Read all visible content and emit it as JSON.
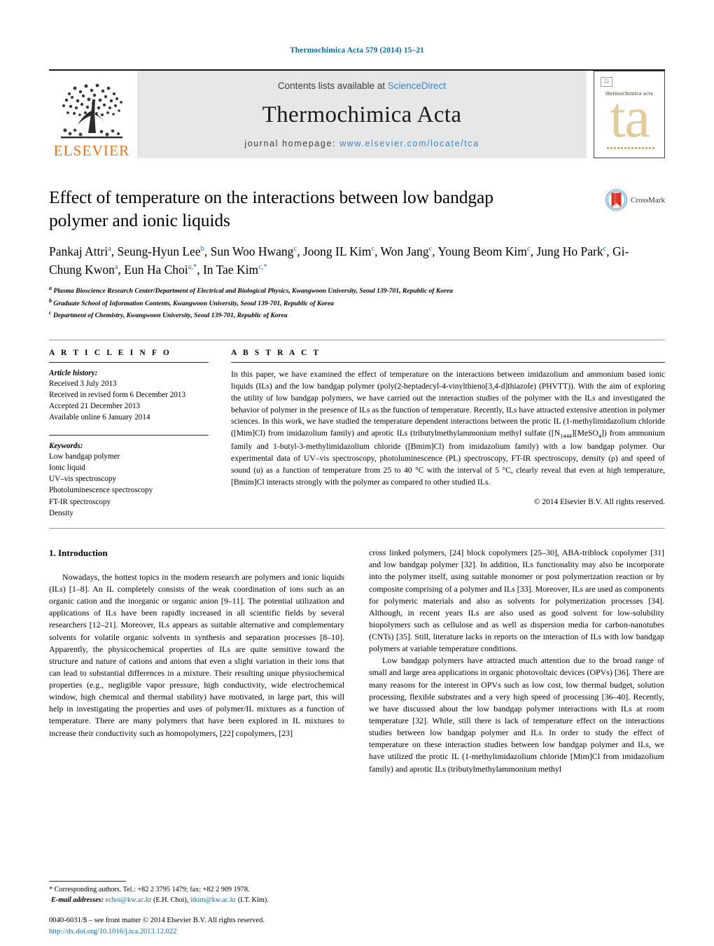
{
  "running_head": "Thermochimica Acta 579 (2014) 15–21",
  "masthead": {
    "publisher_logo_text": "ELSEVIER",
    "contents_prefix": "Contents lists available at",
    "contents_link": "ScienceDirect",
    "journal_title": "Thermochimica Acta",
    "homepage_prefix": "journal homepage:",
    "homepage_url": "www.elsevier.com/locate/tca",
    "cover": {
      "journal_name": "thermochimica acta",
      "monogram": "ta",
      "badge_text": "ELSEVIER"
    }
  },
  "crossmark": {
    "label": "CrossMark"
  },
  "article": {
    "title": "Effect of temperature on the interactions between low bandgap polymer and ionic liquids",
    "authors_line1": "Pankaj Attri",
    "authors": [
      {
        "name": "Pankaj Attri",
        "sup": "a"
      },
      {
        "name": "Seung-Hyun Lee",
        "sup": "b"
      },
      {
        "name": "Sun Woo Hwang",
        "sup": "c"
      },
      {
        "name": "Joong IL Kim",
        "sup": "c"
      },
      {
        "name": "Won Jang",
        "sup": "c"
      },
      {
        "name": "Young Beom Kim",
        "sup": "c"
      },
      {
        "name": "Jung Ho Park",
        "sup": "c"
      },
      {
        "name": "Gi-Chung Kwon",
        "sup": "a"
      },
      {
        "name": "Eun Ha Choi",
        "sup": "a,*"
      },
      {
        "name": "In Tae Kim",
        "sup": "c,*"
      }
    ],
    "affiliations": [
      {
        "sup": "a",
        "text": "Plasma Bioscience Research Center/Department of Electrical and Biological Physics, Kwangwoon University, Seoul 139-701, Republic of Korea"
      },
      {
        "sup": "b",
        "text": "Graduate School of Information Contents, Kwangwoon University, Seoul 139-701, Republic of Korea"
      },
      {
        "sup": "c",
        "text": "Department of Chemistry, Kwangwoon University, Seoul 139-701, Republic of Korea"
      }
    ]
  },
  "article_info": {
    "heading": "A R T I C L E   I N F O",
    "history_label": "Article history:",
    "history": [
      "Received 3 July 2013",
      "Received in revised form 6 December 2013",
      "Accepted 21 December 2013",
      "Available online 6 January 2014"
    ],
    "keywords_label": "Keywords:",
    "keywords": [
      "Low bandgap polymer",
      "Ionic liquid",
      "UV–vis spectroscopy",
      "Photoluminescence spectroscopy",
      "FT-IR spectroscopy",
      "Density"
    ]
  },
  "abstract": {
    "heading": "A B S T R A C T",
    "text_part1": "In this paper, we have examined the effect of temperature on the interactions between imidazolium and ammonium based ionic liquids (ILs) and the low bandgap polymer (poly(2-heptadecyl-4-vinylthieno[3,4-d]thiazole) (PHVTT)). With the aim of exploring the utility of low bandgap polymers, we have carried out the interaction studies of the polymer with the ILs and investigated the behavior of polymer in the presence of ILs as the function of temperature. Recently, ILs have attracted extensive attention in polymer sciences. In this work, we have studied the temperature dependent interactions between the protic IL (1-methylimidazolium chloride ([Mim]Cl) from imidazolium family) and aprotic ILs (tributylmethylammonium methyl sulfate ([N",
    "sub1": "1444",
    "text_part2": "][MeSO",
    "sub2": "4",
    "text_part3": "]) from ammonium family and 1-butyl-3-methylimidazolium chloride ([Bmim]Cl) from imidazolium family) with a low bandgap polymer. Our experimental data of UV–vis spectroscopy, photoluminescence (PL) spectroscopy, FT-IR spectroscopy, density (ρ) and speed of sound (u) as a function of temperature from 25 to 40 °C with the interval of 5 °C, clearly reveal that even at high temperature, [Bmim]Cl interacts strongly with the polymer as compared to other studied ILs.",
    "copyright": "© 2014 Elsevier B.V. All rights reserved."
  },
  "introduction": {
    "number_and_title": "1.  Introduction",
    "left_paragraph": "Nowadays, the hottest topics in the modern research are polymers and ionic liquids (ILs) [1–8]. An IL completely consists of the weak coordination of ions such as an organic cation and the inorganic or organic anion [9–11]. The potential utilization and applications of ILs have been rapidly increased in all scientific fields by several researchers [12–21]. Moreover, ILs appears as suitable alternative and complementary solvents for volatile organic solvents in synthesis and separation processes [8–10]. Apparently, the physicochemical properties of ILs are quite sensitive toward the structure and nature of cations and anions that even a slight variation in their ions that can lead to substantial differences in a mixture. Their resulting unique physiochemical properties (e.g., negligible vapor pressure, high conductivity, wide electrochemical window, high chemical and thermal stability) have motivated, in large part, this will help in investigating the properties and uses of polymer/IL mixtures as a function of temperature. There are many polymers that have been explored in IL mixtures to increase their conductivity such as homopolymers, [22] copolymers, [23]",
    "right_paragraph_1": "cross linked polymers, [24] block copolymers [25–30], ABA-triblock copolymer [31] and low bandgap polymer [32]. In addition, ILs functionality may also be incorporate into the polymer itself, using suitable monomer or post polymerization reaction or by composite comprising of a polymer and ILs [33]. Moreover, ILs are used as components for polymeric materials and also as solvents for polymerization processes [34]. Although, in recent years ILs are also used as good solvent for low-solubility biopolymers such as cellulose and as well as dispersion media for carbon-nanotubes (CNTs) [35]. Still, literature lacks in reports on the interaction of ILs with low bandgap polymers at variable temperature conditions.",
    "right_paragraph_2": "Low bandgap polymers have attracted much attention due to the broad range of small and large area applications in organic photovoltaic devices (OPVs) [36]. There are many reasons for the interest in OPVs such as low cost, low thermal budget, solution processing, flexible substrates and a very high speed of processing [36–40]. Recently, we have discussed about the low bandgap polymer interactions with ILs at room temperature [32]. While, still there is lack of temperature effect on the interactions studies between low bandgap polymer and ILs. In order to study the effect of temperature on these interaction studies between low bandgap polymer and ILs, we have utilized the protic IL (1-methylimidazolium chloride [Mim]Cl from imidazolium family) and aprotic ILs (tributylmethylammonium methyl"
  },
  "footnote": {
    "marker": "*",
    "corresponding": "Corresponding authors. Tel.: +82 2 3795 1479; fax: +82 2 909 1978.",
    "email_label": "E-mail addresses:",
    "email1": "echoi@kw.ac.kr",
    "email1_owner": "(E.H. Choi),",
    "email2": "itkim@kw.ac.kr",
    "email2_owner": "(I.T. Kim)."
  },
  "imprint": {
    "line1": "0040-6031/$ – see front matter © 2014 Elsevier B.V. All rights reserved.",
    "doi": "http://dx.doi.org/10.1016/j.tca.2013.12.022"
  },
  "colors": {
    "link_blue": "#0b6ca0",
    "science_direct_blue": "#3b85c4",
    "elsevier_orange": "#E9711C",
    "band_gray": "#e7e7e7",
    "cover_beige": "#e2cc9a"
  }
}
